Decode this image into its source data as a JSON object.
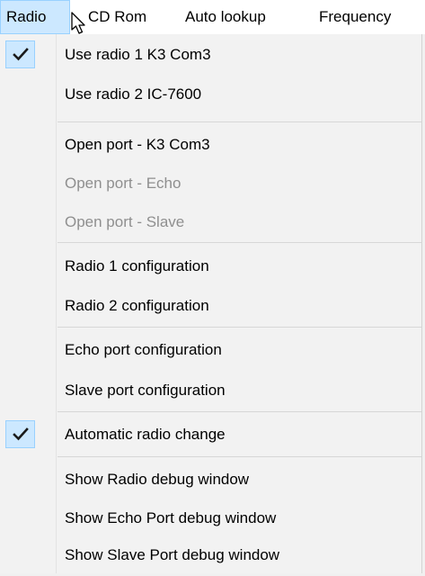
{
  "menubar": {
    "items": [
      {
        "label": "Radio"
      },
      {
        "label": "CD Rom"
      },
      {
        "label": "Auto lookup"
      },
      {
        "label": "Frequency"
      }
    ]
  },
  "menu": {
    "items": [
      {
        "label": "Use radio 1  K3 Com3",
        "checked": true
      },
      {
        "label": "Use radio 2  IC-7600"
      },
      {
        "label": "Open port - K3 Com3"
      },
      {
        "label": "Open port - Echo",
        "disabled": true
      },
      {
        "label": "Open port - Slave",
        "disabled": true
      },
      {
        "label": "Radio 1 configuration"
      },
      {
        "label": "Radio 2 configuration"
      },
      {
        "label": "Echo port configuration"
      },
      {
        "label": "Slave port configuration"
      },
      {
        "label": "Automatic radio change",
        "checked": true
      },
      {
        "label": "Show Radio debug window"
      },
      {
        "label": "Show Echo Port debug window"
      },
      {
        "label": "Show Slave Port debug window"
      }
    ]
  },
  "icons": {
    "check": "checkmark-icon",
    "cursor": "mouse-pointer-icon"
  },
  "colors": {
    "highlight": "#cce8ff",
    "highlight_border": "#99d1ff",
    "disabled_text": "#8f8f8f",
    "menu_bg": "#f2f2f2"
  }
}
